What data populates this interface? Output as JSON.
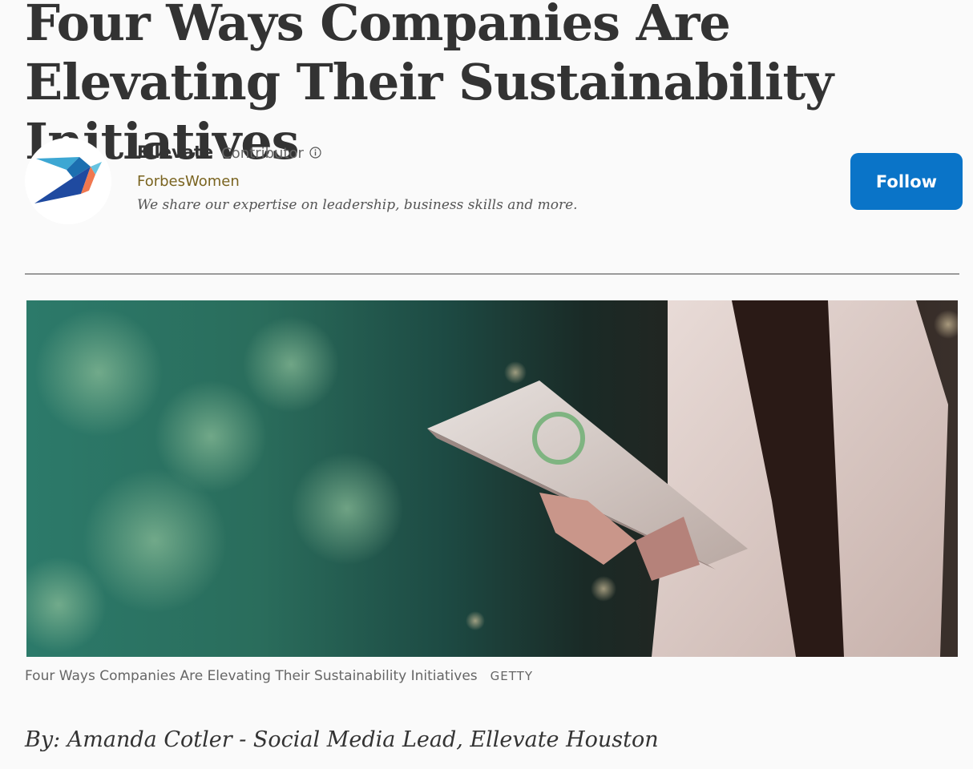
{
  "article": {
    "headline": "Four Ways Companies Are Elevating Their Sustainability Initiatives",
    "author": {
      "name": "Ellevate",
      "role": "Contributor",
      "channel": "ForbesWomen",
      "bio": "We share our expertise on leadership, business skills and more.",
      "avatar_icon": "bird-logo-icon"
    },
    "follow_label": "Follow",
    "hero_image": {
      "caption": "Four Ways Companies Are Elevating Their Sustainability Initiatives",
      "credit": "GETTY",
      "tablet_icon": "recycle-icon"
    },
    "byline": "By: Amanda Cotler - Social Media Lead, Ellevate Houston"
  },
  "colors": {
    "follow_button": "#0a74c8",
    "channel_link": "#7a6420",
    "divider": "#9a9a9a"
  }
}
